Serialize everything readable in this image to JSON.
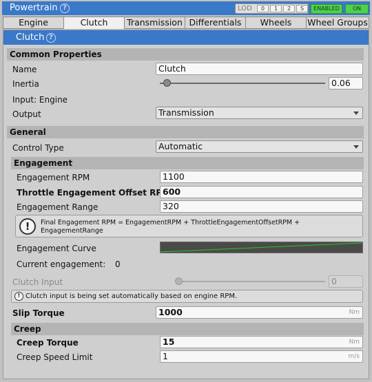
{
  "window": {
    "title": "Powertrain"
  },
  "lod": {
    "label": "LOD",
    "levels": [
      "0",
      "1",
      "2",
      "S"
    ]
  },
  "status": {
    "enabled_label": "ENABLED",
    "on_label": "ON"
  },
  "tabs": [
    {
      "label": "Engine"
    },
    {
      "label": "Clutch"
    },
    {
      "label": "Transmission"
    },
    {
      "label": "Differentials"
    },
    {
      "label": "Wheels"
    },
    {
      "label": "Wheel Groups"
    }
  ],
  "panel": {
    "title": "Clutch"
  },
  "common": {
    "header": "Common Properties",
    "name_label": "Name",
    "name_value": "Clutch",
    "inertia_label": "Inertia",
    "inertia_value": "0.06",
    "inertia_slider": 0.04,
    "input_label": "Input: Engine",
    "output_label": "Output",
    "output_value": "Transmission"
  },
  "general": {
    "header": "General",
    "control_type_label": "Control Type",
    "control_type_value": "Automatic"
  },
  "engagement": {
    "header": "Engagement",
    "rpm_label": "Engagement RPM",
    "rpm_value": "1100",
    "offset_label": "Throttle Engagement Offset RPM",
    "offset_value": "600",
    "range_label": "Engagement Range",
    "range_value": "320",
    "info_line1": "Final Engagement RPM = EngagementRPM + ThrottleEngagementOffsetRPM +",
    "info_line2": "EngagementRange",
    "curve_label": "Engagement Curve",
    "current_label": "Current engagement:",
    "current_value": "0"
  },
  "clutch_input": {
    "label": "Clutch Input",
    "value": "0",
    "slider": 0,
    "info": "Clutch input is being set automatically based on engine RPM."
  },
  "slip_torque": {
    "label": "Slip Torque",
    "value": "1000",
    "unit": "Nm"
  },
  "creep": {
    "header": "Creep",
    "torque_label": "Creep Torque",
    "torque_value": "15",
    "torque_unit": "Nm",
    "speed_label": "Creep Speed Limit",
    "speed_value": "1",
    "speed_unit": "m/s"
  },
  "colors": {
    "accent": "#3a78c8",
    "enabled": "#4fd14f",
    "curve_line": "#22cc22"
  }
}
